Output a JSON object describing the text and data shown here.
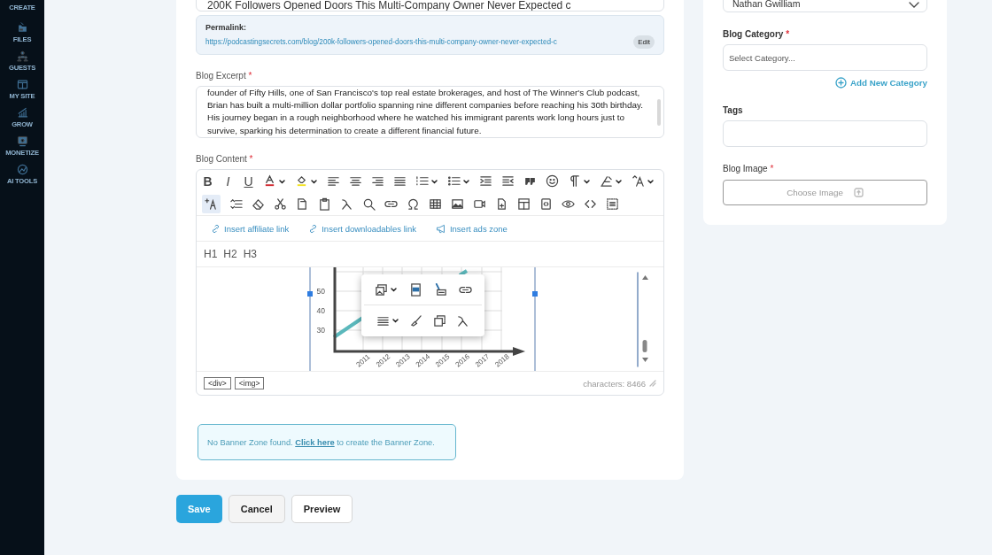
{
  "sidebar": {
    "items": [
      {
        "label": "CREATE",
        "kind": "create"
      },
      {
        "label": "FILES",
        "kind": "files"
      },
      {
        "label": "GUESTS",
        "kind": "guests"
      },
      {
        "label": "MY SITE",
        "kind": "site"
      },
      {
        "label": "GROW",
        "kind": "grow"
      },
      {
        "label": "MONETIZE",
        "kind": "monetize"
      },
      {
        "label": "AI TOOLS",
        "kind": "ai"
      }
    ]
  },
  "post_form": {
    "title_field": {
      "value": "200K Followers Opened Doors This Multi-Company Owner Never Expected c"
    },
    "permalink": {
      "label": "Permalink:",
      "url": "https://podcastingsecrets.com/blog/200k-followers-opened-doors-this-multi-company-owner-never-expected-c",
      "edit_button": "Edit"
    },
    "excerpt": {
      "label": "Blog Excerpt",
      "required_mark": "*",
      "value": "founder of Fifty Hills, one of San Francisco's top real estate brokerages, and host of The Winner's Club podcast, Brian has built a multi-million dollar portfolio spanning nine different companies before reaching his 30th birthday. His journey began in a rough neighborhood where he watched his immigrant parents work long hours just to survive, sparking his determination to create a different financial future."
    },
    "content": {
      "label": "Blog Content",
      "required_mark": "*",
      "text_buttons": [
        {
          "label": "B",
          "kind": "bold"
        },
        {
          "label": "I",
          "kind": "italic"
        },
        {
          "label": "U",
          "kind": "underline"
        }
      ],
      "insert_links": [
        {
          "label": "Insert affiliate link",
          "kind": "link"
        },
        {
          "label": "Insert downloadables link",
          "kind": "link"
        },
        {
          "label": "Insert ads zone",
          "kind": "megaphone"
        }
      ],
      "headings": [
        "H1",
        "H2",
        "H3"
      ],
      "embedded_chart": {
        "y_ticks": [
          "50",
          "40",
          "30"
        ],
        "x_ticks": [
          "2011",
          "2012",
          "2013",
          "2014",
          "2015",
          "2016",
          "2017",
          "2018"
        ]
      },
      "path_tags": [
        "<div>",
        "<img>"
      ],
      "character_count": "characters: 8466"
    },
    "banner_notice": {
      "before": "No Banner Zone found.",
      "link": "Click here",
      "after": "to create the Banner Zone."
    }
  },
  "actions": [
    {
      "label": "Save",
      "kind": "primary"
    },
    {
      "label": "Cancel",
      "kind": "secondary"
    },
    {
      "label": "Preview",
      "kind": "outline"
    }
  ],
  "side_panel": {
    "author_select": {
      "value": "Nathan Gwilliam"
    },
    "category": {
      "label": "Blog Category",
      "required_mark": "*",
      "placeholder": "Select Category..."
    },
    "add_category_link": "Add New Category",
    "tags": {
      "label": "Tags"
    },
    "image": {
      "label": "Blog Image",
      "required_mark": "*",
      "button": "Choose Image"
    }
  }
}
